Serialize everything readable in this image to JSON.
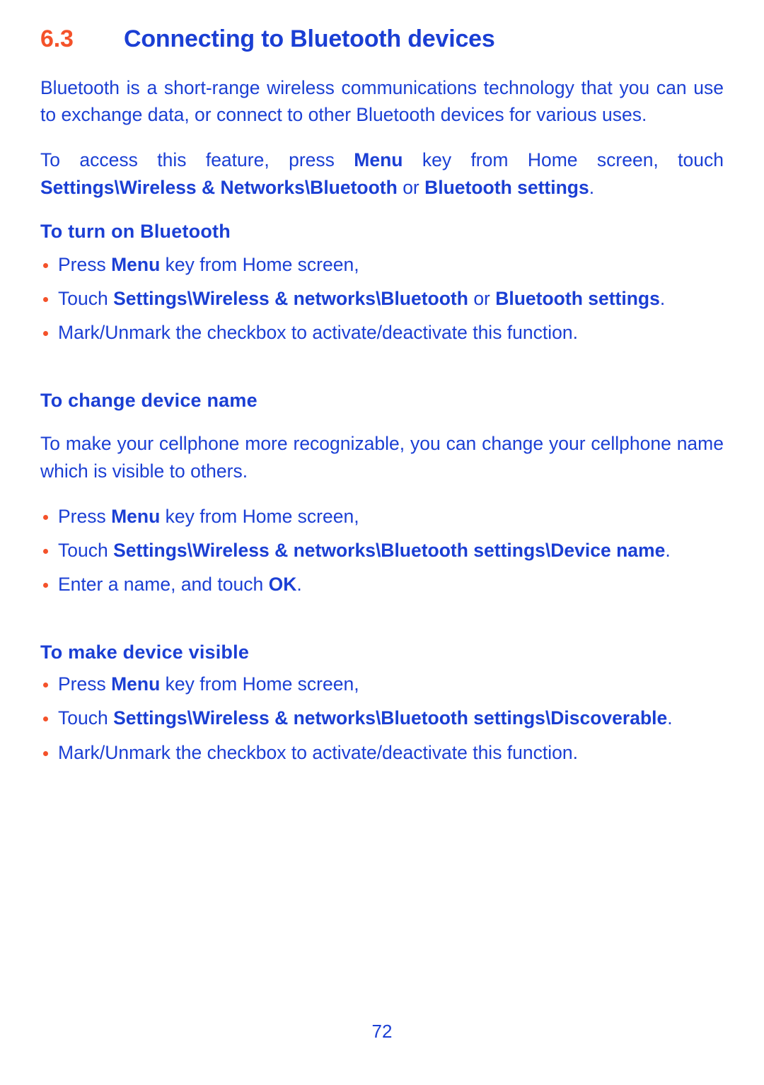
{
  "colors": {
    "body_blue": "#1b3fd4",
    "accent_orange": "#f4522a"
  },
  "heading": {
    "number": "6.3",
    "title": "Connecting to Bluetooth devices"
  },
  "intro_paragraph": "Bluetooth is a short-range wireless communications technology that you can use to exchange data, or connect to other Bluetooth devices for various uses.",
  "access_paragraph": {
    "part1": "To access this feature, press ",
    "bold1": "Menu",
    "part2": " key from Home screen, touch ",
    "bold2": "Settings\\Wireless & Networks\\Bluetooth",
    "part3": " or ",
    "bold3": "Bluetooth settings",
    "part4": "."
  },
  "sections": [
    {
      "heading": "To turn on Bluetooth",
      "bullets": [
        {
          "part1": "Press ",
          "bold1": "Menu",
          "part2": " key from Home screen,"
        },
        {
          "part1": "Touch ",
          "bold1": "Settings\\Wireless & networks\\Bluetooth",
          "part2": " or ",
          "bold2": "Bluetooth settings",
          "part3": "."
        },
        {
          "part1": "Mark/Unmark the checkbox to activate/deactivate this function."
        }
      ]
    },
    {
      "heading": "To change device name",
      "paragraph": "To make your cellphone more recognizable, you can change your cellphone name which is visible to others.",
      "bullets": [
        {
          "part1": "Press ",
          "bold1": "Menu",
          "part2": " key from Home screen,"
        },
        {
          "part1": "Touch ",
          "bold1": "Settings\\Wireless & networks\\Bluetooth settings\\Device name",
          "part2": "."
        },
        {
          "part1": "Enter a name, and touch ",
          "bold1": "OK",
          "part2": "."
        }
      ]
    },
    {
      "heading": "To make device visible",
      "bullets": [
        {
          "part1": "Press ",
          "bold1": "Menu",
          "part2": " key from Home screen,"
        },
        {
          "part1": "Touch ",
          "bold1": "Settings\\Wireless & networks\\Bluetooth settings\\Discoverable",
          "part2": "."
        },
        {
          "part1": "Mark/Unmark the checkbox to activate/deactivate this function."
        }
      ]
    }
  ],
  "footer": {
    "page_number": "72"
  }
}
